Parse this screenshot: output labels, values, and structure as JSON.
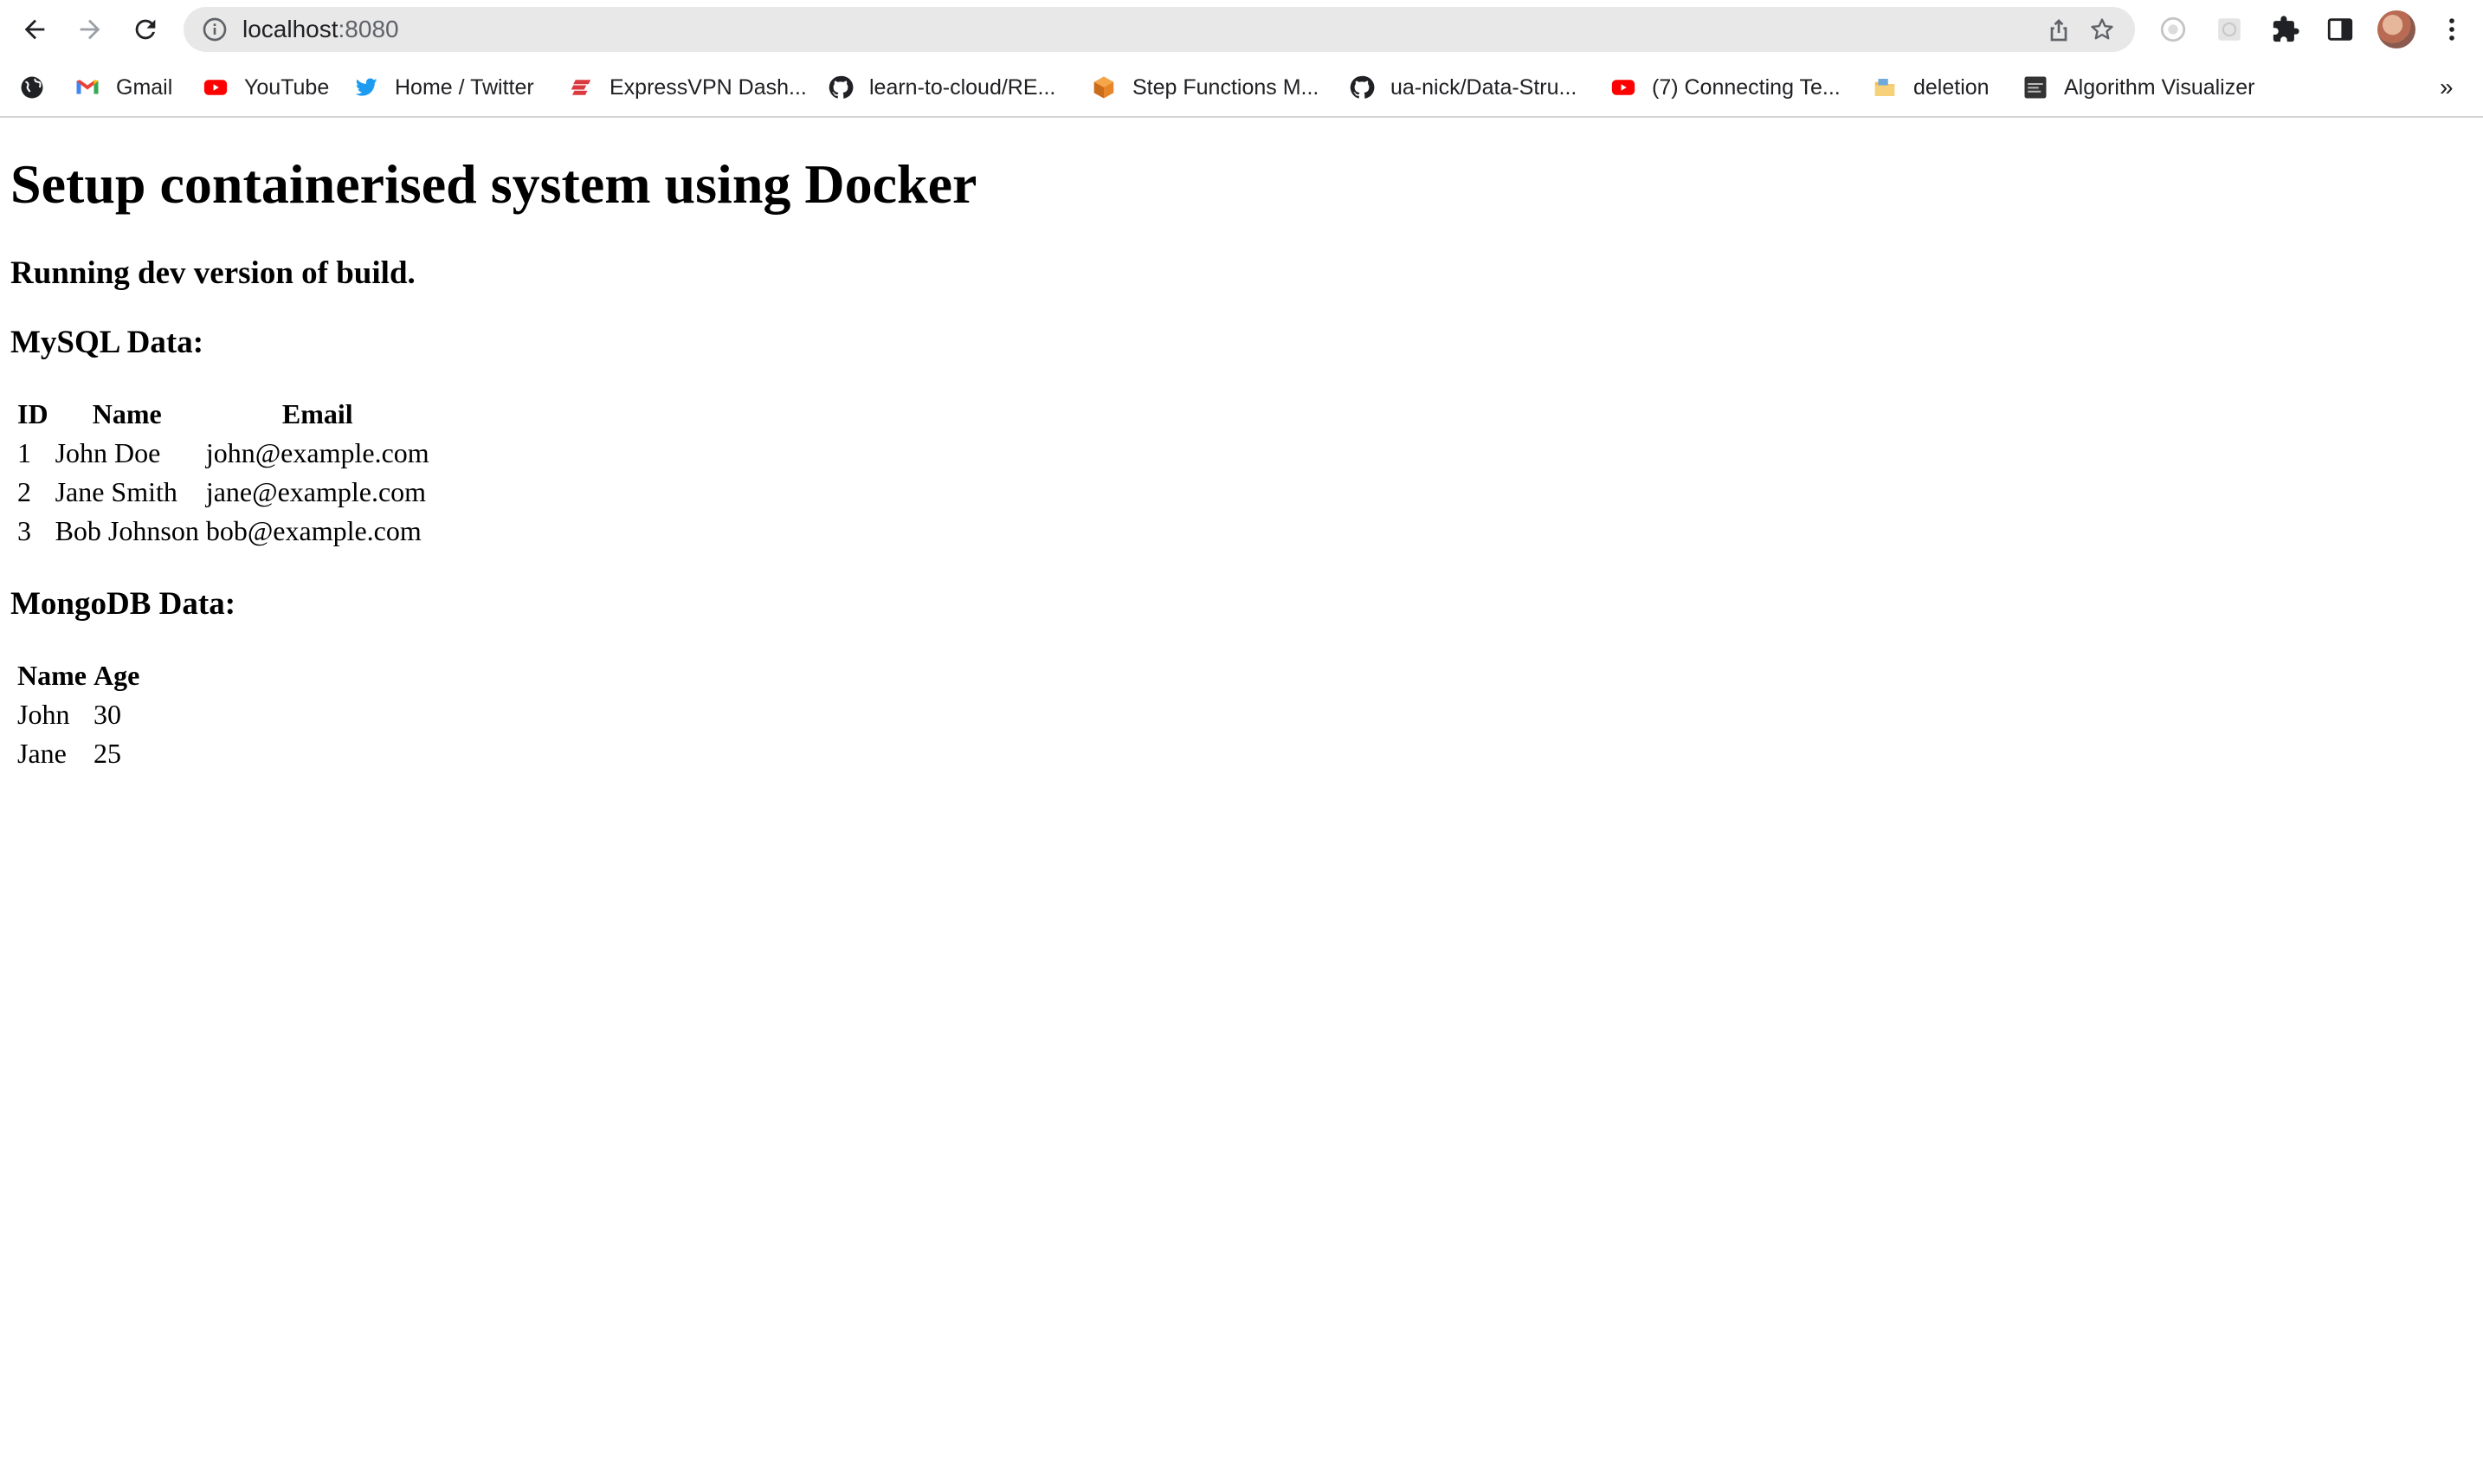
{
  "browser": {
    "url_host": "localhost",
    "url_port": ":8080",
    "bookmarks": [
      {
        "label": "",
        "icon": "globe-icon"
      },
      {
        "label": "Gmail",
        "icon": "gmail-icon"
      },
      {
        "label": "YouTube",
        "icon": "youtube-icon"
      },
      {
        "label": "Home / Twitter",
        "icon": "twitter-icon"
      },
      {
        "label": "ExpressVPN Dash...",
        "icon": "expressvpn-icon"
      },
      {
        "label": "learn-to-cloud/RE...",
        "icon": "github-icon"
      },
      {
        "label": "Step Functions M...",
        "icon": "aws-icon"
      },
      {
        "label": "ua-nick/Data-Stru...",
        "icon": "github-icon"
      },
      {
        "label": "(7) Connecting Te...",
        "icon": "youtube-icon"
      },
      {
        "label": "deletion",
        "icon": "folder-icon"
      },
      {
        "label": "Algorithm Visualizer",
        "icon": "algorithm-visualizer-icon"
      }
    ],
    "overflow": "»"
  },
  "page": {
    "title": "Setup containerised system using Docker",
    "subtitle": "Running dev version of build.",
    "mysql": {
      "heading": "MySQL Data:",
      "headers": [
        "ID",
        "Name",
        "Email"
      ],
      "rows": [
        [
          "1",
          "John Doe",
          "john@example.com"
        ],
        [
          "2",
          "Jane Smith",
          "jane@example.com"
        ],
        [
          "3",
          "Bob Johnson",
          "bob@example.com"
        ]
      ]
    },
    "mongodb": {
      "heading": "MongoDB Data:",
      "headers": [
        "Name",
        "Age"
      ],
      "rows": [
        [
          "John",
          "30"
        ],
        [
          "Jane",
          "25"
        ]
      ]
    }
  }
}
